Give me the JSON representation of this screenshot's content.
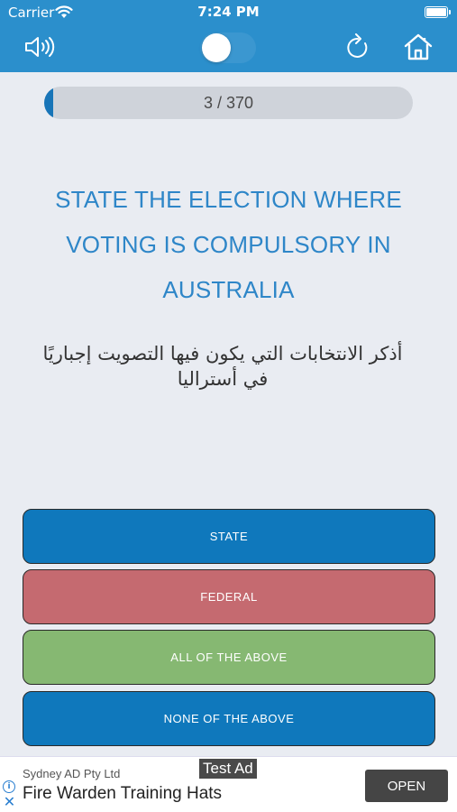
{
  "status_bar": {
    "carrier": "Carrier",
    "time": "7:24 PM"
  },
  "toolbar": {
    "sound_icon": "speaker-volume-icon",
    "reload_icon": "reload-icon",
    "home_icon": "home-icon",
    "toggle_on": true
  },
  "progress": {
    "text": "3 / 370",
    "current": 3,
    "total": 370,
    "fraction": 0.0081
  },
  "question": {
    "english": "STATE THE ELECTION WHERE VOTING IS COMPULSORY IN AUSTRALIA",
    "arabic": "أذكر الانتخابات التي يكون فيها التصويت إجباريًا في أستراليا"
  },
  "answers": [
    {
      "label": "STATE",
      "color": "#0f78bc"
    },
    {
      "label": "FEDERAL",
      "color": "#c56a70"
    },
    {
      "label": "ALL OF THE ABOVE",
      "color": "#86b872"
    },
    {
      "label": "NONE OF THE ABOVE",
      "color": "#0f78bc"
    }
  ],
  "ad": {
    "sponsor": "Sydney AD Pty Ltd",
    "title": "Fire Warden Training Hats",
    "tag": "Test Ad",
    "button": "OPEN"
  },
  "colors": {
    "header": "#2b8fcc",
    "accent_text": "#2e86c8",
    "background": "#e9ecf2"
  }
}
